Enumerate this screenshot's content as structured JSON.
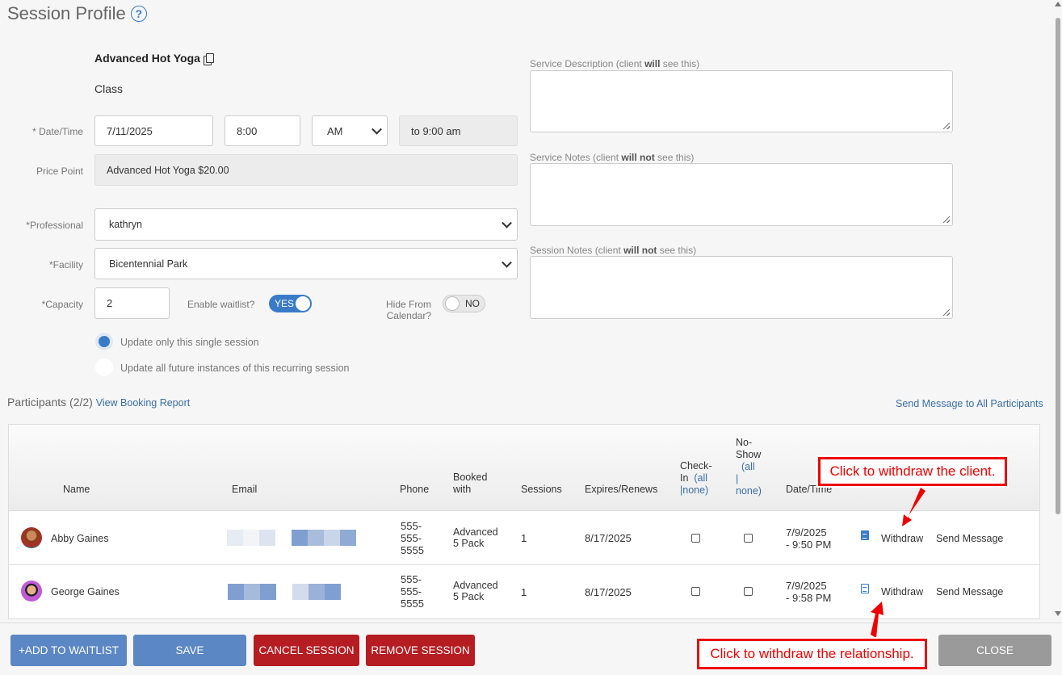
{
  "header": {
    "title": "Session Profile",
    "help": "?"
  },
  "service": {
    "name": "Advanced Hot Yoga",
    "type": "Class"
  },
  "form": {
    "datetime_label": "* Date/Time",
    "date": "7/11/2025",
    "time": "8:00",
    "ampm": "AM",
    "end_time": "to 9:00 am",
    "price_label": "Price Point",
    "price": "Advanced Hot Yoga $20.00",
    "professional_label": "*Professional",
    "professional": "kathryn",
    "facility_label": "*Facility",
    "facility": "Bicentennial Park",
    "capacity_label": "*Capacity",
    "capacity": "2",
    "waitlist_label": "Enable waitlist?",
    "waitlist_value": "YES",
    "hide_label_1": "Hide From",
    "hide_label_2": "Calendar?",
    "hide_value": "NO",
    "radio_single": "Update only this single session",
    "radio_all": "Update all future instances of this recurring session"
  },
  "notes": {
    "desc_pre": "Service Description (client ",
    "desc_bold": "will",
    "desc_post": " see this)",
    "service_pre": "Service Notes (client ",
    "service_bold": "will not",
    "service_post": " see this)",
    "session_pre": "Session Notes (client ",
    "session_bold": "will not",
    "session_post": " see this)"
  },
  "participants": {
    "title": "Participants (2/2)",
    "report_link": "View Booking Report",
    "send_all": "Send Message to All Participants",
    "headers": {
      "name": "Name",
      "email": "Email",
      "phone": "Phone",
      "booked_1": "Booked",
      "booked_2": "with",
      "sessions": "Sessions",
      "expires": "Expires/Renews",
      "checkin_1": "Check-",
      "checkin_2": "In",
      "checkin_all": "(all",
      "checkin_sep": "|",
      "checkin_none": "none)",
      "noshow_1": "No-",
      "noshow_2": "Show",
      "noshow_all": "(all",
      "noshow_sep": "|",
      "noshow_none": "none)",
      "datetime": "Date/Time"
    },
    "rows": [
      {
        "name": "Abby Gaines",
        "phone_1": "555-",
        "phone_2": "555-",
        "phone_3": "5555",
        "booked_1": "Advanced",
        "booked_2": "5 Pack",
        "sessions": "1",
        "expires": "8/17/2025",
        "date_1": "7/9/2025",
        "date_2": "- 9:50 PM",
        "withdraw": "Withdraw",
        "send": "Send Message"
      },
      {
        "name": "George Gaines",
        "phone_1": "555-",
        "phone_2": "555-",
        "phone_3": "5555",
        "booked_1": "Advanced",
        "booked_2": "5 Pack",
        "sessions": "1",
        "expires": "8/17/2025",
        "date_1": "7/9/2025",
        "date_2": "- 9:58 PM",
        "withdraw": "Withdraw",
        "send": "Send Message"
      }
    ]
  },
  "callouts": {
    "client": "Click to withdraw the client.",
    "relationship": "Click to withdraw the relationship."
  },
  "footer": {
    "waitlist": "+ADD TO WAITLIST",
    "save": "SAVE",
    "cancel": "CANCEL SESSION",
    "remove": "REMOVE SESSION",
    "close": "CLOSE"
  },
  "colors": {
    "accent": "#3a7bc8",
    "danger": "#b51d22",
    "callout": "#e00000"
  }
}
